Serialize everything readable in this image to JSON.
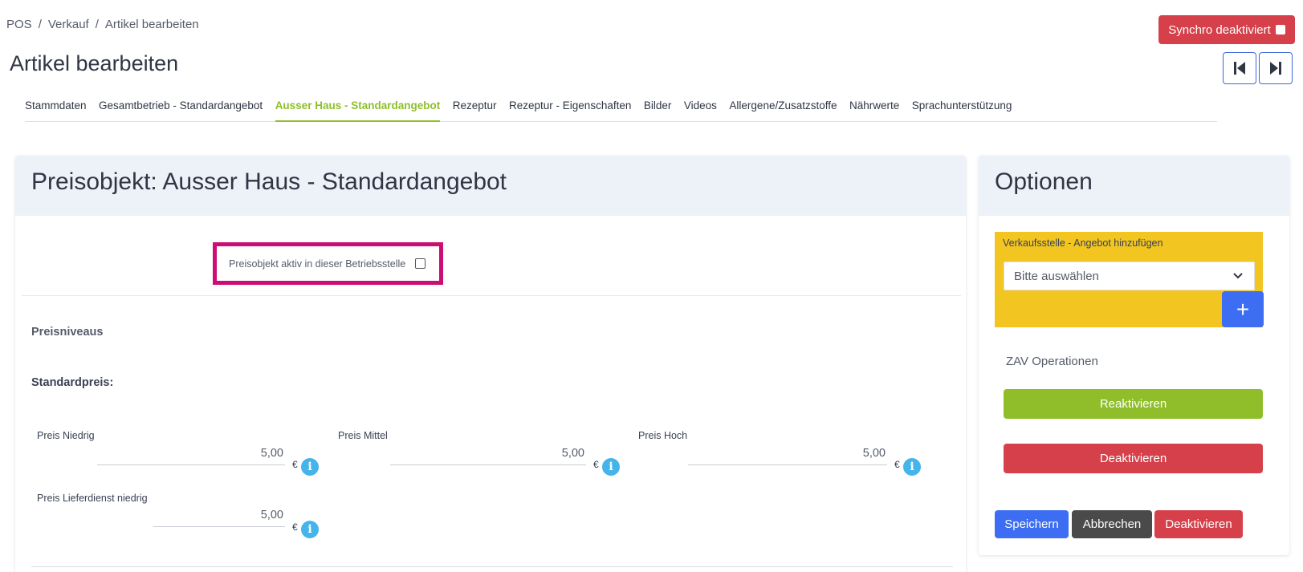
{
  "breadcrumb": {
    "items": [
      "POS",
      "Verkauf",
      "Artikel bearbeiten"
    ],
    "separator": "/"
  },
  "page_title": "Artikel bearbeiten",
  "synchro_button": {
    "label": "Synchro deaktiviert",
    "color": "#d6404a"
  },
  "nav": {
    "prev_icon": "skip-start-icon",
    "next_icon": "skip-end-icon"
  },
  "tabs": [
    {
      "label": "Stammdaten",
      "active": false
    },
    {
      "label": "Gesamtbetrieb - Standardangebot",
      "active": false
    },
    {
      "label": "Ausser Haus - Standardangebot",
      "active": true
    },
    {
      "label": "Rezeptur",
      "active": false
    },
    {
      "label": "Rezeptur - Eigenschaften",
      "active": false
    },
    {
      "label": "Bilder",
      "active": false
    },
    {
      "label": "Videos",
      "active": false
    },
    {
      "label": "Allergene/Zusatzstoffe",
      "active": false
    },
    {
      "label": "Nährwerte",
      "active": false
    },
    {
      "label": "Sprachunterstützung",
      "active": false
    }
  ],
  "main_card": {
    "title": "Preisobjekt: Ausser Haus - Standardangebot",
    "active_checkbox_label": "Preisobjekt aktiv in dieser Betriebsstelle",
    "active_checked": false,
    "preisniveaus_label": "Preisniveaus",
    "standardpreis_label": "Standardpreis:",
    "currency": "€",
    "prices": {
      "niedrig": {
        "label": "Preis Niedrig",
        "value": "5,00"
      },
      "mittel": {
        "label": "Preis Mittel",
        "value": "5,00"
      },
      "hoch": {
        "label": "Preis Hoch",
        "value": "5,00"
      },
      "lieferdienst_niedrig": {
        "label": "Preis Lieferdienst niedrig",
        "value": "5,00"
      }
    }
  },
  "options_card": {
    "title": "Optionen",
    "verkaufsstelle_label": "Verkaufsstelle - Angebot hinzufügen",
    "select_value": "Bitte auswählen",
    "add_button": "+",
    "zav_label": "ZAV Operationen",
    "reaktivieren": "Reaktivieren",
    "deaktivieren": "Deaktivieren"
  },
  "footer_buttons": {
    "save": "Speichern",
    "cancel": "Abbrechen",
    "deactivate": "Deaktivieren"
  },
  "colors": {
    "accent_green": "#8fbe2a",
    "danger": "#d6404a",
    "primary": "#3c6df2",
    "highlight_border": "#cc0d73",
    "option_box": "#f2c521",
    "info": "#45b4ea"
  }
}
